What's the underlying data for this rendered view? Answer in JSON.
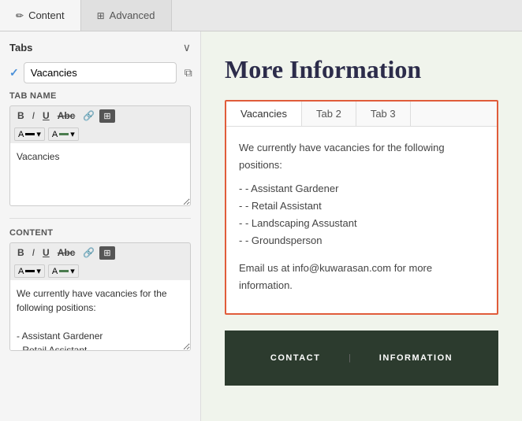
{
  "tabs": {
    "content_label": "Content",
    "advanced_label": "Advanced",
    "content_icon": "✏",
    "advanced_icon": "⊞"
  },
  "left_panel": {
    "sections_title": "Tabs",
    "tab_name_label": "Tab Name",
    "content_label": "Content",
    "tab_item": {
      "name": "Vacancies",
      "checked": true
    },
    "tab_name_toolbar": {
      "bold": "B",
      "italic": "I",
      "underline": "U",
      "strikethrough": "Abc",
      "link": "🔗",
      "grid": "⊞"
    },
    "tab_name_value": "Vacancies",
    "content_toolbar": {
      "bold": "B",
      "italic": "I",
      "underline": "U",
      "strikethrough": "Abc",
      "link": "🔗",
      "grid": "⊞"
    },
    "content_value": "We currently have vacancies for the following positions:\n\n- Assistant Gardener\n- Retail Assistant"
  },
  "preview": {
    "title": "More Information",
    "tabs": [
      {
        "label": "Vacancies",
        "active": true
      },
      {
        "label": "Tab 2",
        "active": false
      },
      {
        "label": "Tab 3",
        "active": false
      }
    ],
    "body_intro": "We currently have vacancies for the following positions:",
    "body_list": [
      "- Assistant Gardener",
      "- Retail Assistant",
      "- Landscaping Assustant",
      "- Groundsperson"
    ],
    "body_footer": "Email us at info@kuwarasan.com for more information."
  },
  "footer": {
    "left": "CONTACT",
    "right": "INFORMATION"
  }
}
